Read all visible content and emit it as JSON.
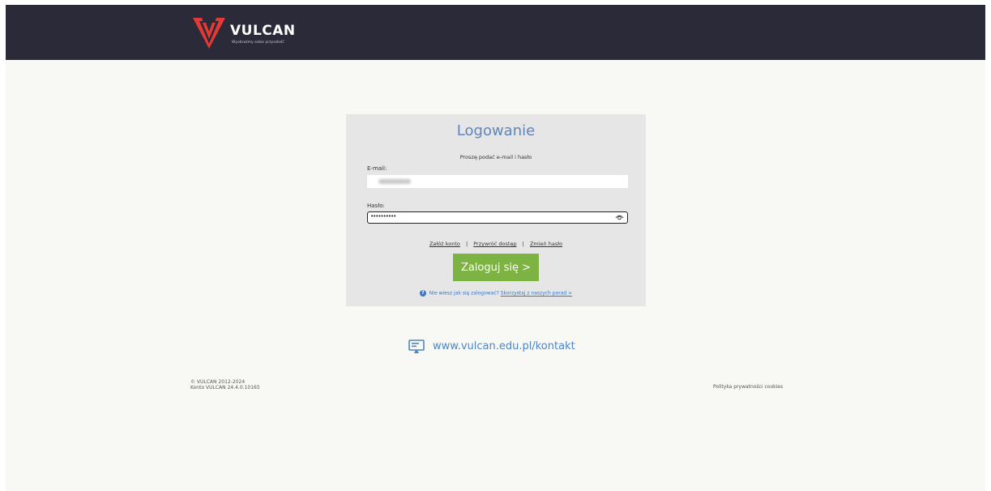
{
  "header": {
    "logo_text": "VULCAN",
    "logo_tagline": "Wyobraźmy sobie przyszłość",
    "bg_color": "#2a2a38",
    "logo_icon": "vulcan-v-logo-icon"
  },
  "login": {
    "title": "Logowanie",
    "subtitle": "Proszę podać e-mail i hasło",
    "email_label": "E-mail:",
    "email_value": "",
    "password_label": "Hasło:",
    "password_value": "••••••••••",
    "show_password_icon": "eye-icon",
    "links": {
      "create_account": "Załóż konto",
      "restore_access": "Przywróć dostęp",
      "change_password": "Zmień hasło",
      "separator": "|"
    },
    "submit_label": "Zaloguj się >",
    "help_text": "Nie wiesz jak się zalogować?",
    "help_link": "Skorzystaj z naszych porad >",
    "accent_color": "#7cb342"
  },
  "contact": {
    "icon": "monitor-icon",
    "text": "www.vulcan.edu.pl/kontakt"
  },
  "footer": {
    "copyright": "© VULCAN 2012-2024",
    "version": "Konto VULCAN 24.4.0.10165",
    "privacy_link": "Polityka prywatności cookies"
  }
}
